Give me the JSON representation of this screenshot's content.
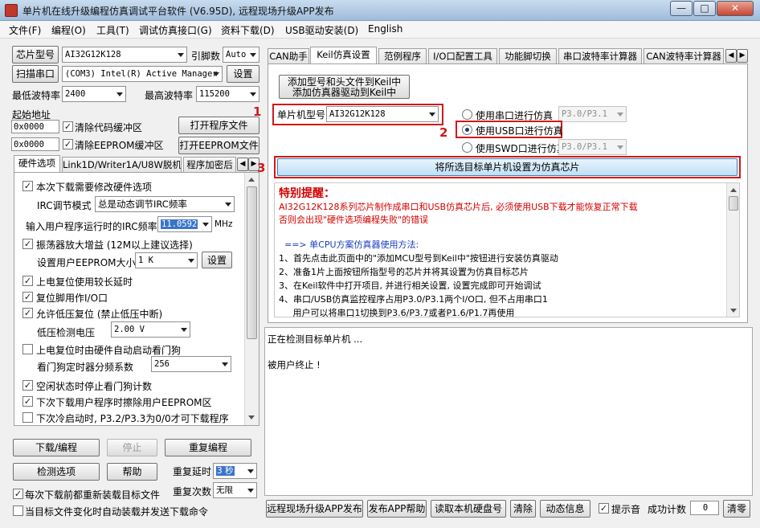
{
  "window": {
    "title": "单片机在线升级编程仿真调试平台软件 (V6.95D), 远程现场升级APP发布"
  },
  "menu": [
    "文件(F)",
    "编程(O)",
    "工具(T)",
    "调试仿真接口(G)",
    "资料下载(D)",
    "USB驱动安装(D)",
    "English"
  ],
  "left": {
    "chip_button": "芯片型号",
    "chip_value": "AI32G12K128",
    "pins_label": "引脚数",
    "pins_value": "Auto",
    "scan_button": "扫描串口",
    "port_value": "(COM3) Intel(R) Active Manager",
    "settings_button": "设置",
    "min_baud_label": "最低波特率",
    "min_baud_value": "2400",
    "max_baud_label": "最高波特率",
    "max_baud_value": "115200",
    "start_addr_label": "起始地址",
    "addr1": "0x0000",
    "clear_code": "清除代码缓冲区",
    "open_prog": "打开程序文件",
    "addr2": "0x0000",
    "clear_eeprom": "清除EEPROM缓冲区",
    "open_eeprom": "打开EEPROM文件",
    "tabs": [
      "硬件选项",
      "Link1D/Writer1A/U8W脱机",
      "程序加密后"
    ],
    "hw": {
      "opt1": "本次下载需要修改硬件选项",
      "irc_label": "IRC调节模式",
      "irc_value": "总是动态调节IRC频率",
      "freq_label": "输入用户程序运行时的IRC频率",
      "freq_value": "11.0592",
      "freq_unit": "MHz",
      "opt2": "振荡器放大增益 (12M以上建议选择)",
      "eeprom_label": "设置用户EEPROM大小",
      "eeprom_value": "1   K",
      "eeprom_set": "设置",
      "opt3": "上电复位使用较长延时",
      "opt4": "复位脚用作I/O口",
      "opt5": "允许低压复位 (禁止低压中断)",
      "lv_label": "低压检测电压",
      "lv_value": "2.00 V",
      "opt6": "上电复位时由硬件自动启动看门狗",
      "wdt_label": "看门狗定时器分频系数",
      "wdt_value": "256",
      "opt7": "空闲状态时停止看门狗计数",
      "opt8": "下次下载用户程序时擦除用户EEPROM区",
      "opt9": "下次冷启动时, P3.2/P3.3为0/0才可下载程序"
    },
    "download_button": "下载/编程",
    "stop_button": "停止",
    "reprog_button": "重复编程",
    "detect_button": "检测选项",
    "help_button": "帮助",
    "repeat_delay_label": "重复延时",
    "repeat_delay_value": "3 秒",
    "repeat_count_label": "重复次数",
    "repeat_count_value": "无限",
    "reload_label": "每次下载前都重新装载目标文件",
    "auto_send_label": "当目标文件变化时自动装载并发送下载命令"
  },
  "right": {
    "tabs": [
      "CAN助手",
      "Keil仿真设置",
      "范例程序",
      "I/O口配置工具",
      "功能脚切换",
      "串口波特率计算器",
      "CAN波特率计算器"
    ],
    "add_keil_line1": "添加型号和头文件到Keil中",
    "add_keil_line2": "添加仿真器驱动到Keil中",
    "mcu_label": "单片机型号",
    "mcu_value": "AI32G12K128",
    "radio_uart": "使用串口进行仿真",
    "radio_uart_value": "P3.0/P3.1",
    "radio_usb": "使用USB口进行仿真",
    "radio_swd": "使用SWD口进行仿真",
    "radio_swd_value": "P3.0/P3.1",
    "set_target_button": "将所选目标单片机设置为仿真芯片",
    "annotations": [
      "1",
      "2",
      "3"
    ],
    "notice_title": "特别提醒：",
    "notice_red1": "AI32G12K128系列芯片制作成串口和USB仿真芯片后, 必须使用USB下载才能恢复正常下载",
    "notice_red2": "否则会出现\"硬件选项编程失败\"的错误",
    "notice_blue": "==> 单CPU方案仿真器使用方法:",
    "steps": [
      "1、首先点击此页面中的\"添加MCU型号到Keil中\"按钮进行安装仿真驱动",
      "2、准备1片上面按钮所指型号的芯片并将其设置为仿真目标芯片",
      "3、在Keil软件中打开项目, 并进行相关设置, 设置完成即可开始调试",
      "4、串口/USB仿真监控程序占用P3.0/P3.1两个I/O口, 但不占用串口1",
      "     用户可以将串口1切换到P3.6/P3.7或者P1.6/P1.7再使用"
    ],
    "log": [
      "正在检测目标单片机 ...",
      "被用户终止 !"
    ],
    "bottom": {
      "publish": "远程现场升级APP发布",
      "publish_help": "发布APP帮助",
      "read_disk": "读取本机硬盘号",
      "clear": "清除",
      "dynamic": "动态信息",
      "beep_label": "提示音",
      "success_label": "成功计数",
      "success_value": "0",
      "reset": "清零"
    }
  }
}
